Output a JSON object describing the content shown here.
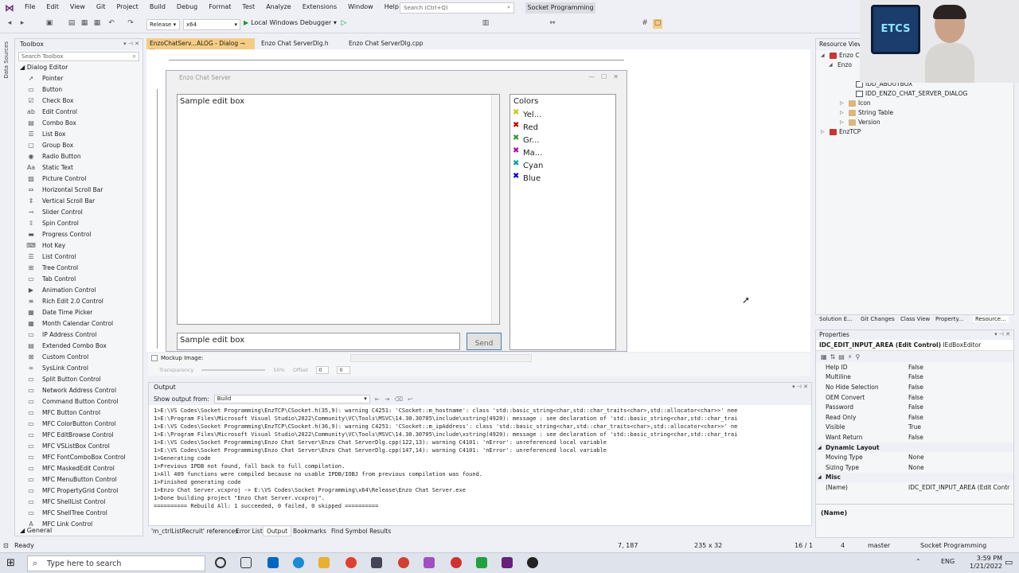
{
  "menubar": {
    "items": [
      "File",
      "Edit",
      "View",
      "Git",
      "Project",
      "Build",
      "Debug",
      "Format",
      "Test",
      "Analyze",
      "Extensions",
      "Window",
      "Help"
    ],
    "search_placeholder": "Search (Ctrl+Q)",
    "project_title": "Socket Programming"
  },
  "toolbar": {
    "config": "Release",
    "platform": "x64",
    "debugger": "Local Windows Debugger"
  },
  "leftstrip": {
    "label": "Data Sources"
  },
  "toolbox": {
    "title": "Toolbox",
    "search_placeholder": "Search Toolbox",
    "section": "Dialog Editor",
    "items": [
      "Pointer",
      "Button",
      "Check Box",
      "Edit Control",
      "Combo Box",
      "List Box",
      "Group Box",
      "Radio Button",
      "Static Text",
      "Picture Control",
      "Horizontal Scroll Bar",
      "Vertical Scroll Bar",
      "Slider Control",
      "Spin Control",
      "Progress Control",
      "Hot Key",
      "List Control",
      "Tree Control",
      "Tab Control",
      "Animation Control",
      "Rich Edit 2.0 Control",
      "Date Time Picker",
      "Month Calendar Control",
      "IP Address Control",
      "Extended Combo Box",
      "Custom Control",
      "SysLink Control",
      "Split Button Control",
      "Network Address Control",
      "Command Button Control",
      "MFC Button Control",
      "MFC ColorButton Control",
      "MFC EditBrowse Control",
      "MFC VSListBox Control",
      "MFC FontComboBox Control",
      "MFC MaskedEdit Control",
      "MFC MenuButton Control",
      "MFC PropertyGrid Control",
      "MFC ShellList Control",
      "MFC ShellTree Control",
      "MFC Link Control"
    ],
    "footer": "General"
  },
  "doc_tabs": [
    "EnzoChatServ...ALOG - Dialog",
    "Enzo Chat ServerDlg.h",
    "Enzo Chat ServerDlg.cpp"
  ],
  "dialog": {
    "title": "Enzo Chat Server",
    "edit1": "Sample edit box",
    "edit2": "Sample edit box",
    "send": "Send",
    "colors_label": "Colors",
    "colors": [
      {
        "name": "Yel...",
        "color": "#c8c800"
      },
      {
        "name": "Red",
        "color": "#c00000"
      },
      {
        "name": "Gr...",
        "color": "#2a9a2a"
      },
      {
        "name": "Ma...",
        "color": "#b000b0"
      },
      {
        "name": "Cyan",
        "color": "#00a0a0"
      },
      {
        "name": "Blue",
        "color": "#0000c0"
      }
    ]
  },
  "mockup": {
    "label": "Mockup Image:",
    "transparency": "Transparency",
    "percent": "50%",
    "offset": "Offset",
    "offset_x": "0",
    "offset_y": "0"
  },
  "output": {
    "title": "Output",
    "show_label": "Show output from:",
    "source": "Build",
    "lines": [
      "1>E:\\VS Codes\\Socket Programming\\EnzTCP\\CSocket.h(35,9): warning C4251: 'CSocket::m_hostname': class 'std::basic_string<char,std::char_traits<char>,std::allocator<char>>' nee",
      "1>E:\\Program Files\\Microsoft Visual Studio\\2022\\Community\\VC\\Tools\\MSVC\\14.30.30705\\include\\xstring(4920): message : see declaration of 'std::basic_string<char,std::char_trai",
      "1>E:\\VS Codes\\Socket Programming\\EnzTCP\\CSocket.h(36,9): warning C4251: 'CSocket::m_ipAddress': class 'std::basic_string<char,std::char_traits<char>,std::allocator<char>>' ne",
      "1>E:\\Program Files\\Microsoft Visual Studio\\2022\\Community\\VC\\Tools\\MSVC\\14.30.30705\\include\\xstring(4920): message : see declaration of 'std::basic_string<char,std::char_trai",
      "1>E:\\VS Codes\\Socket Programming\\Enzo Chat Server\\Enzo Chat ServerDlg.cpp(122,13): warning C4101: 'nError': unreferenced local variable",
      "1>E:\\VS Codes\\Socket Programming\\Enzo Chat Server\\Enzo Chat ServerDlg.cpp(147,14): warning C4101: 'nError': unreferenced local variable",
      "1>Generating code",
      "1>Previous IPDB not found, fall back to full compilation.",
      "1>All 409 functions were compiled because no usable IPDB/IOBJ from previous compilation was found.",
      "1>Finished generating code",
      "1>Enzo Chat Server.vcxproj -> E:\\VS Codes\\Socket Programming\\x64\\Release\\Enzo Chat Server.exe",
      "1>Done building project \"Enzo Chat Server.vcxproj\".",
      "========== Rebuild All: 1 succeeded, 0 failed, 0 skipped =========="
    ],
    "tabs": [
      "'m_ctrlListRecruit' references",
      "Error List",
      "Output",
      "Bookmarks",
      "Find Symbol Results"
    ]
  },
  "resview": {
    "title": "Resource View",
    "root": "Enzo Ch",
    "child": "Enzo",
    "items": [
      "IDD_ABOUTBOX",
      "IDD_ENZO_CHAT_SERVER_DIALOG",
      "Icon",
      "String Table",
      "Version",
      "EnzTCP"
    ],
    "tabs": [
      "Solution E...",
      "Git Changes",
      "Class View",
      "Property...",
      "Resource..."
    ]
  },
  "props": {
    "title": "Properties",
    "selected": "IDC_EDIT_INPUT_AREA (Edit Control)",
    "selected_type": "IEdBoxEditor",
    "rows": [
      {
        "k": "Help ID",
        "v": "False"
      },
      {
        "k": "Multiline",
        "v": "False"
      },
      {
        "k": "No Hide Selection",
        "v": "False"
      },
      {
        "k": "OEM Convert",
        "v": "False"
      },
      {
        "k": "Password",
        "v": "False"
      },
      {
        "k": "Read Only",
        "v": "False"
      },
      {
        "k": "Visible",
        "v": "True"
      },
      {
        "k": "Want Return",
        "v": "False"
      }
    ],
    "cat1": "Dynamic Layout",
    "rows2": [
      {
        "k": "Moving Type",
        "v": "None"
      },
      {
        "k": "Sizing Type",
        "v": "None"
      }
    ],
    "cat2": "Misc",
    "rows3": [
      {
        "k": "(Name)",
        "v": "IDC_EDIT_INPUT_AREA (Edit Contr"
      }
    ],
    "desc": "(Name)"
  },
  "status": {
    "ready": "Ready",
    "pos": "7, 187",
    "size": "235 x 32",
    "line": "16 / 1",
    "changes": "4",
    "branch": "master",
    "repo": "Socket Programming"
  },
  "taskbar": {
    "search": "Type here to search",
    "lang": "ENG",
    "time": "3:59 PM",
    "date": "1/21/2022"
  },
  "webcam": {
    "logo": "ETCS"
  }
}
